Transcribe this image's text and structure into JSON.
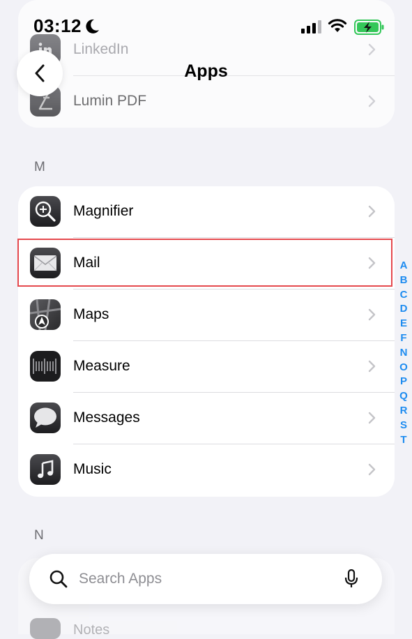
{
  "status_bar": {
    "time": "03:12"
  },
  "nav": {
    "title": "Apps"
  },
  "top_section": {
    "items": [
      {
        "label": "LinkedIn",
        "icon": "linkedin-icon"
      },
      {
        "label": "Lumin PDF",
        "icon": "lumin-pdf-icon"
      }
    ]
  },
  "section_m": {
    "letter": "M",
    "items": [
      {
        "label": "Magnifier",
        "icon": "magnifier-icon"
      },
      {
        "label": "Mail",
        "icon": "mail-icon",
        "highlighted": true
      },
      {
        "label": "Maps",
        "icon": "maps-icon"
      },
      {
        "label": "Measure",
        "icon": "measure-icon"
      },
      {
        "label": "Messages",
        "icon": "messages-icon"
      },
      {
        "label": "Music",
        "icon": "music-icon"
      }
    ]
  },
  "section_n": {
    "letter": "N",
    "items": [
      {
        "label": "Notes",
        "icon": "notes-icon"
      }
    ]
  },
  "alpha_index": [
    "A",
    "B",
    "C",
    "D",
    "E",
    "F",
    "N",
    "O",
    "P",
    "Q",
    "R",
    "S",
    "T"
  ],
  "search": {
    "placeholder": "Search Apps"
  },
  "colors": {
    "accent": "#1e8cf0",
    "highlight": "#e5484d",
    "battery": "#34c759"
  }
}
